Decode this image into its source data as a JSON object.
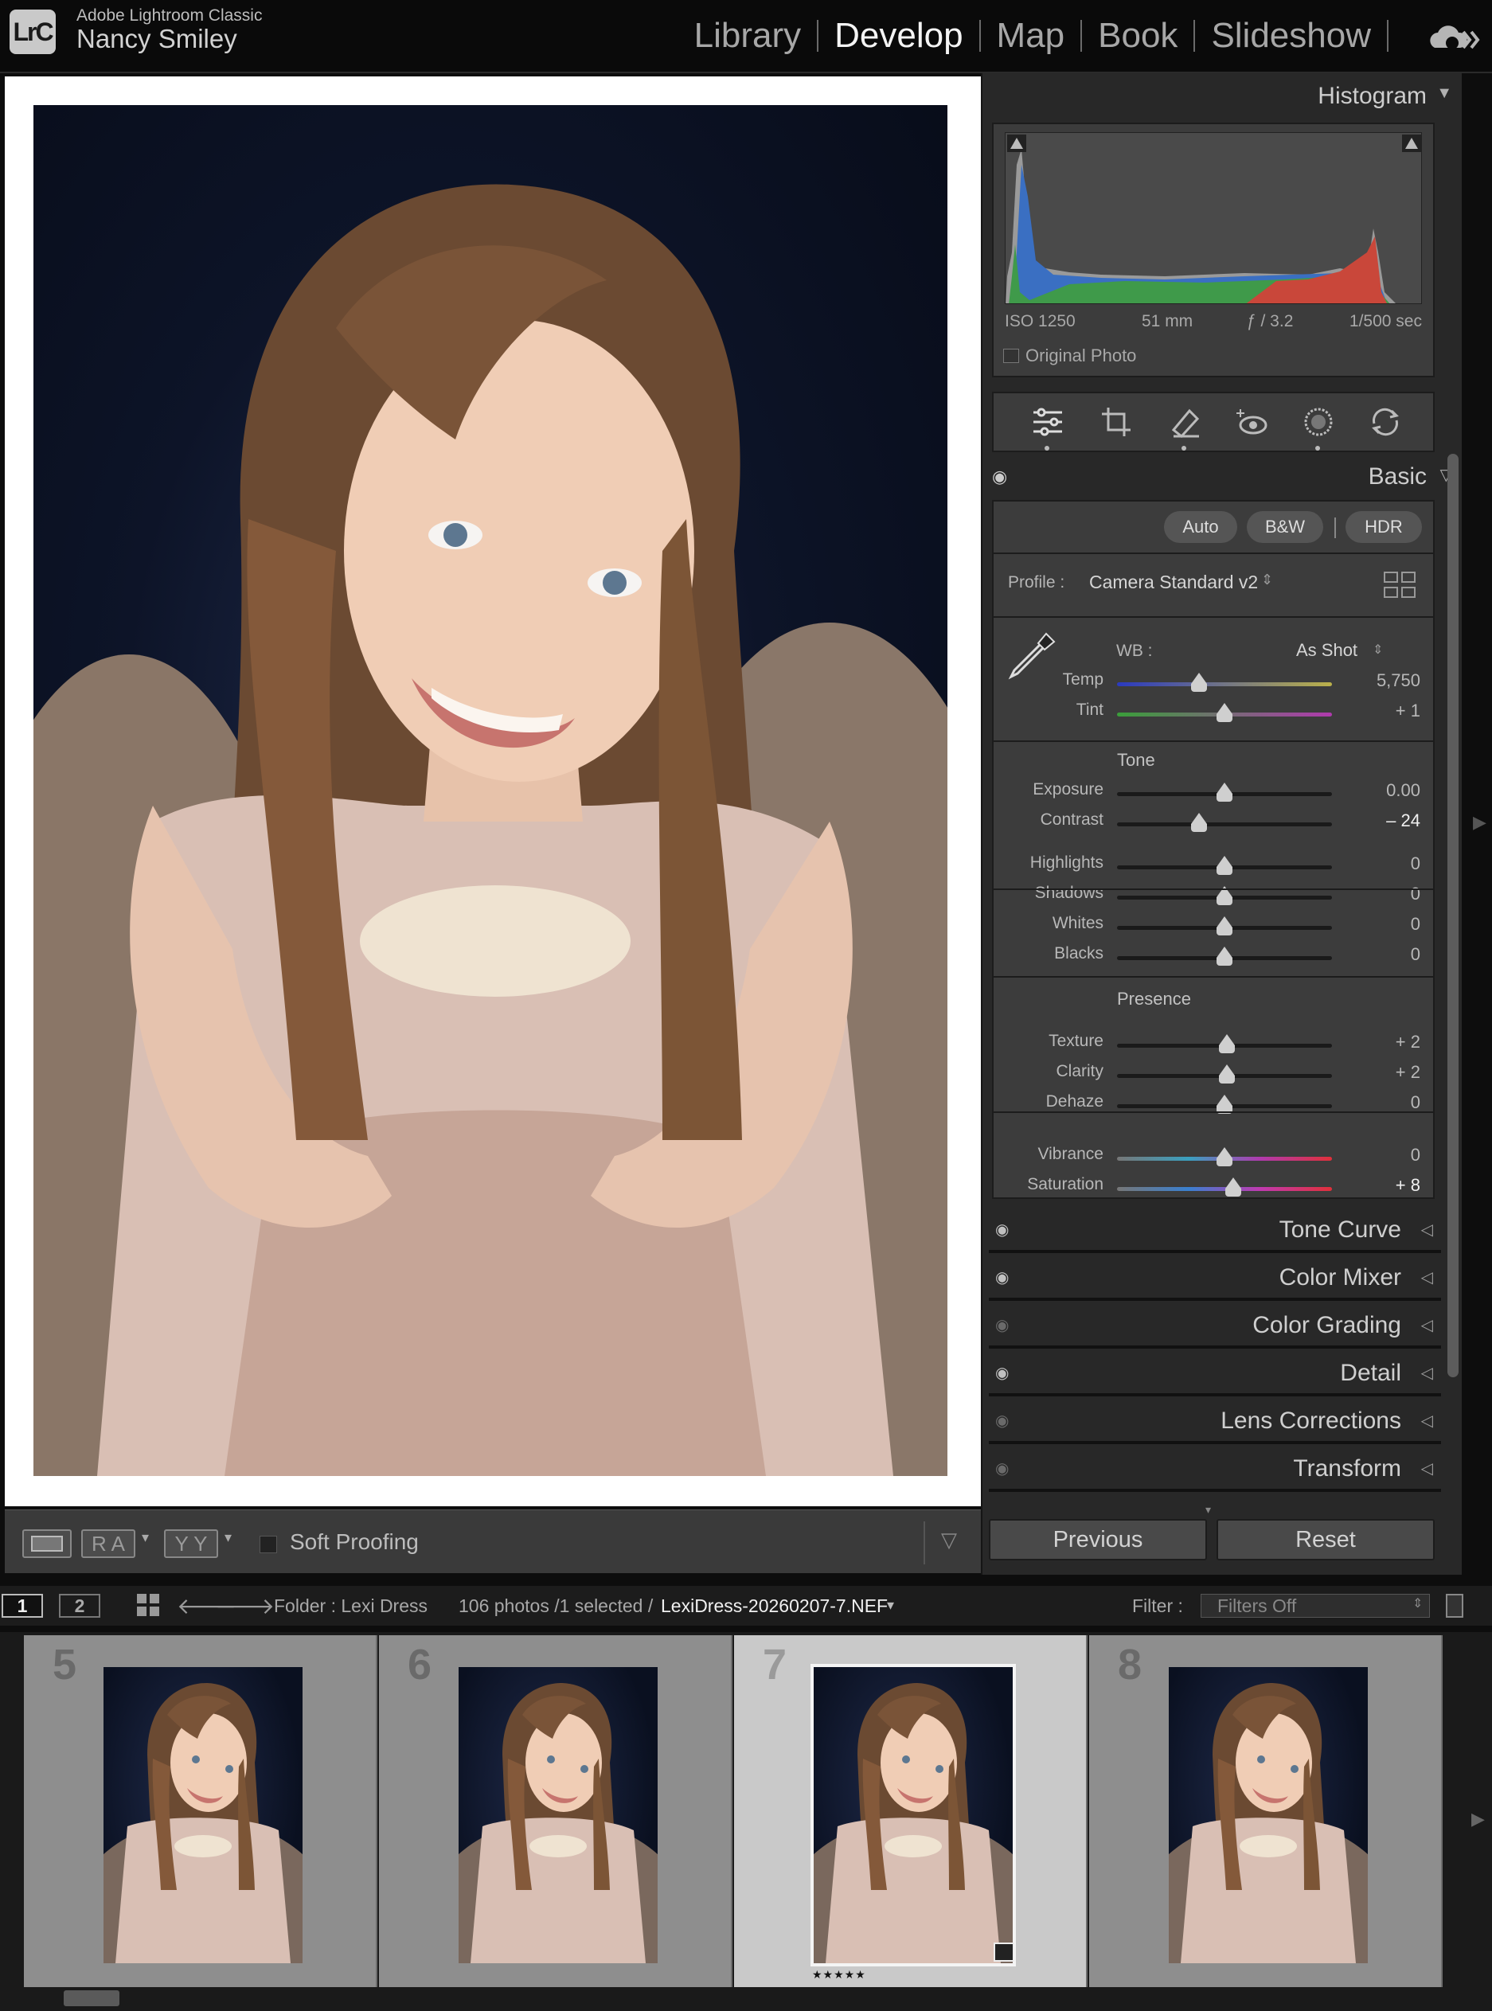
{
  "app": {
    "name": "Adobe Lightroom Classic",
    "logo": "LrC",
    "user": "Nancy Smiley"
  },
  "modules": [
    {
      "label": "Library",
      "active": false
    },
    {
      "label": "Develop",
      "active": true
    },
    {
      "label": "Map",
      "active": false
    },
    {
      "label": "Book",
      "active": false
    },
    {
      "label": "Slideshow",
      "active": false
    }
  ],
  "histogram": {
    "title": "Histogram",
    "iso": "ISO 1250",
    "focal": "51 mm",
    "aperture": "ƒ / 3.2",
    "shutter": "1/500 sec",
    "original_photo": "Original Photo"
  },
  "basic": {
    "title": "Basic",
    "auto": "Auto",
    "bw": "B&W",
    "hdr": "HDR",
    "profile_label": "Profile :",
    "profile_value": "Camera Standard v2",
    "wb_label": "WB :",
    "wb_value": "As Shot",
    "tone_label": "Tone",
    "presence_label": "Presence",
    "sliders": [
      {
        "label": "Temp",
        "value": "5,750",
        "pos": 0.38
      },
      {
        "label": "Tint",
        "value": "+ 1",
        "pos": 0.5
      },
      {
        "label": "Exposure",
        "value": "0.00",
        "pos": 0.5
      },
      {
        "label": "Contrast",
        "value": "– 24",
        "pos": 0.38
      },
      {
        "label": "Highlights",
        "value": "0",
        "pos": 0.5
      },
      {
        "label": "Shadows",
        "value": "0",
        "pos": 0.5
      },
      {
        "label": "Whites",
        "value": "0",
        "pos": 0.5
      },
      {
        "label": "Blacks",
        "value": "0",
        "pos": 0.5
      },
      {
        "label": "Texture",
        "value": "+ 2",
        "pos": 0.51
      },
      {
        "label": "Clarity",
        "value": "+ 2",
        "pos": 0.51
      },
      {
        "label": "Dehaze",
        "value": "0",
        "pos": 0.5
      },
      {
        "label": "Vibrance",
        "value": "0",
        "pos": 0.5
      },
      {
        "label": "Saturation",
        "value": "+ 8",
        "pos": 0.54
      }
    ]
  },
  "panels": [
    {
      "label": "Tone Curve",
      "visible": true
    },
    {
      "label": "Color Mixer",
      "visible": true
    },
    {
      "label": "Color Grading",
      "visible": false
    },
    {
      "label": "Detail",
      "visible": true
    },
    {
      "label": "Lens Corrections",
      "visible": false
    },
    {
      "label": "Transform",
      "visible": false
    }
  ],
  "buttons": {
    "previous": "Previous",
    "reset": "Reset"
  },
  "toolbar": {
    "soft_proofing": "Soft Proofing",
    "ra": "R A",
    "yy": "Y Y"
  },
  "filmbar": {
    "screen1": "1",
    "screen2": "2",
    "folder": "Folder : Lexi Dress",
    "count": "106 photos /1 selected /",
    "file": "LexiDress-20260207-7.NEF",
    "filter_label": "Filter :",
    "filter_value": "Filters Off"
  },
  "filmstrip": [
    {
      "num": "5",
      "selected": false
    },
    {
      "num": "6",
      "selected": false
    },
    {
      "num": "7",
      "selected": true,
      "stars": "★★★★★"
    },
    {
      "num": "8",
      "selected": false
    }
  ],
  "colors": {
    "accent": "#f4f4f4",
    "panel": "#282828",
    "section": "#3c3c3c"
  }
}
